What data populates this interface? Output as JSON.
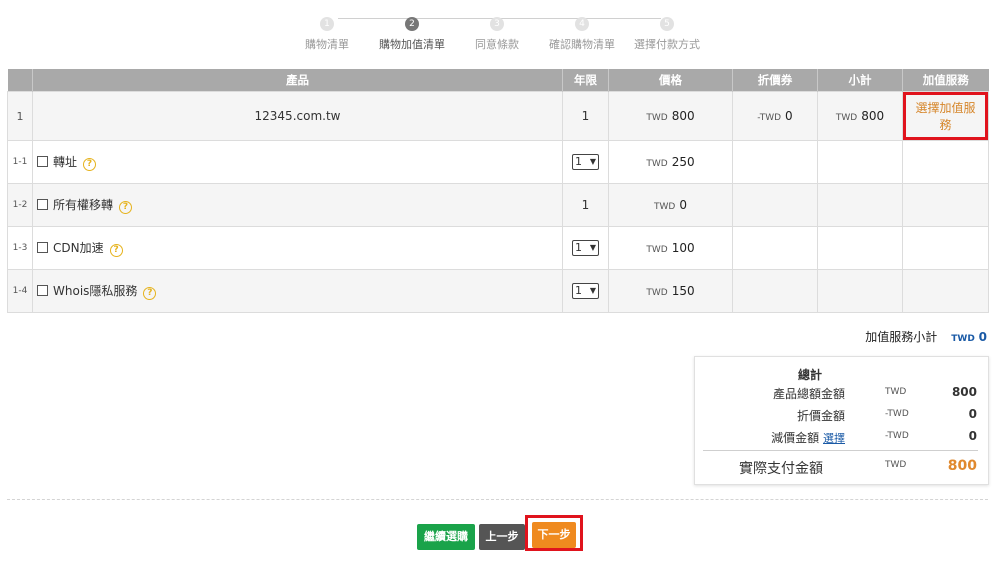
{
  "steps": [
    {
      "num": "1",
      "label": "購物清單"
    },
    {
      "num": "2",
      "label": "購物加值清單"
    },
    {
      "num": "3",
      "label": "同意條款"
    },
    {
      "num": "4",
      "label": "確認購物清單"
    },
    {
      "num": "5",
      "label": "選擇付款方式"
    }
  ],
  "table": {
    "headers": [
      "",
      "產品",
      "年限",
      "價格",
      "折價券",
      "小計",
      "加值服務"
    ],
    "main_row": {
      "idx": "1",
      "product": "12345.com.tw",
      "years": "1",
      "price_cur": "TWD",
      "price": "800",
      "coupon_cur": "-TWD",
      "coupon": "0",
      "subtotal_cur": "TWD",
      "subtotal": "800",
      "vas_button": "選擇加值服務"
    },
    "rows": [
      {
        "idx": "1-1",
        "name": "轉址",
        "years": "1",
        "price_cur": "TWD",
        "price": "250"
      },
      {
        "idx": "1-2",
        "name": "所有權移轉",
        "years": "1",
        "price_cur": "TWD",
        "price": "0"
      },
      {
        "idx": "1-3",
        "name": "CDN加速",
        "years": "1",
        "price_cur": "TWD",
        "price": "100"
      },
      {
        "idx": "1-4",
        "name": "Whois隱私服務",
        "years": "1",
        "price_cur": "TWD",
        "price": "150"
      }
    ],
    "help_glyph": "?"
  },
  "vas_subtotal": {
    "label": "加值服務小計",
    "cur": "TWD",
    "value": "0"
  },
  "summary": {
    "title": "總計",
    "product_total": {
      "label": "產品總額金額",
      "cur": "TWD",
      "value": "800"
    },
    "discount": {
      "label": "折價金額",
      "cur": "-TWD",
      "value": "0"
    },
    "reduction": {
      "label": "減價金額",
      "link": "選擇",
      "cur": "-TWD",
      "value": "0"
    },
    "pay": {
      "label": "實際支付金額",
      "cur": "TWD",
      "value": "800"
    }
  },
  "buttons": {
    "continue": "繼續選購",
    "prev": "上一步",
    "next": "下一步"
  },
  "colors": {
    "accent_orange": "#ef8a1f",
    "green": "#1aa34a",
    "highlight_red": "#e0131d",
    "link_blue": "#1a5aa6"
  }
}
